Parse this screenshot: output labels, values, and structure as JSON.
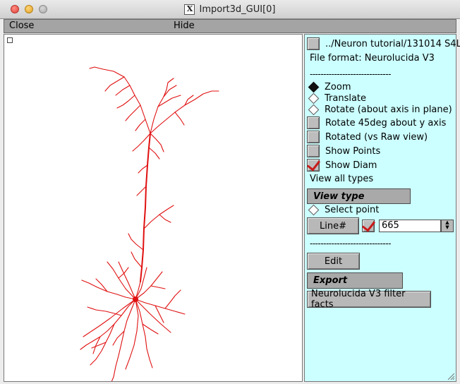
{
  "window": {
    "title": "Import3d_GUI[0]"
  },
  "menubar": {
    "close_label": "Close",
    "hide_label": "Hide"
  },
  "panel": {
    "file_button_label": "../Neuron tutorial/131014 S4L",
    "file_format": "File format: Neurolucida V3",
    "separator": "------------------------------",
    "zoom_label": "Zoom",
    "translate_label": "Translate",
    "rotate_label": "Rotate (about axis in plane)",
    "rotate45_label": "Rotate 45deg about y axis",
    "rotated_label": "Rotated (vs Raw view)",
    "show_points_label": "Show Points",
    "show_diam_label": "Show Diam",
    "view_all_types_label": "View all types",
    "view_type_label": "View type",
    "select_point_label": "Select point",
    "line_button_label": "Line#",
    "line_value": "665",
    "edit_label": "Edit",
    "export_label": "Export",
    "filter_facts_label": "Neurolucida V3 filter facts"
  },
  "state": {
    "mode_selected": "Zoom",
    "show_diam_checked": true,
    "line_checked": true
  },
  "colors": {
    "neuron": "#e01010",
    "panel_bg": "#ccffff"
  },
  "icons": {
    "close": "close-traffic-light-icon",
    "minimize": "minimize-traffic-light-icon",
    "zoom": "zoom-traffic-light-icon",
    "x11": "x11-logo-icon"
  }
}
